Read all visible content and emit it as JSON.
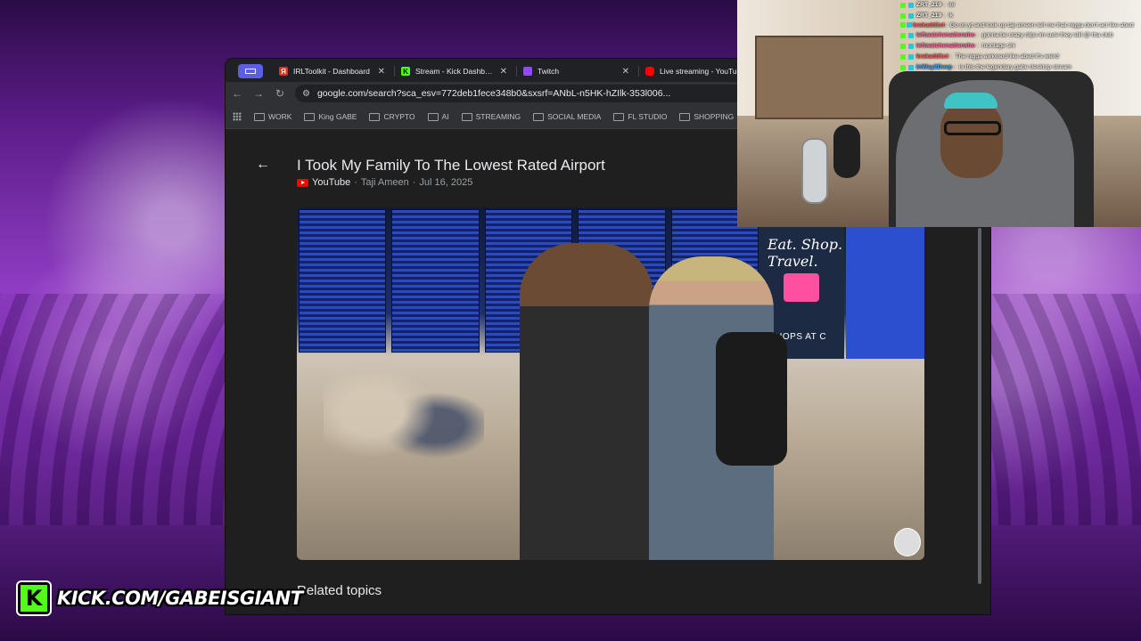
{
  "browser": {
    "tabs": [
      {
        "label": "IRLToolkit - Dashboard",
        "icon": "irltoolkit-icon",
        "color": "#d93025"
      },
      {
        "label": "Stream - Kick Dashboard",
        "icon": "kick-icon",
        "color": "#53fc18"
      },
      {
        "label": "Twitch",
        "icon": "twitch-icon",
        "color": "#9146ff"
      },
      {
        "label": "Live streaming - YouTube",
        "icon": "youtube-icon",
        "color": "#ff0000"
      }
    ],
    "url": "google.com/search?sca_esv=772deb1fece348b0&sxsrf=ANbL-n5HK-hZIlk-353l006...",
    "bookmarks": [
      "WORK",
      "King GABE",
      "CRYPTO",
      "AI",
      "STREAMING",
      "SOCIAL MEDIA",
      "FL STUDIO",
      "SHOPPING"
    ]
  },
  "video": {
    "title": "I Took My Family To The Lowest Rated Airport",
    "source": "YouTube",
    "channel": "Taji Ameen",
    "date": "Jul 16, 2025",
    "ad_text": "Eat. Shop. Travel.",
    "ad_shops": "SHOPS AT C"
  },
  "related_label": "Related topics",
  "chat": [
    {
      "user": "ZRT_219",
      "msg": "lol",
      "color": "#ffffff"
    },
    {
      "user": "ZRT_219",
      "msg": "lk",
      "color": "#ffffff"
    },
    {
      "user": "krakadd1ct",
      "msg": "Go on yt and look up taji ameen tell me that nigga don't act like abed",
      "color": "#ff5f5f"
    },
    {
      "user": "leftwatchenatterwho",
      "msg": "gonna be crazy clips im sure they still @ tha club",
      "color": "#ff6fa8"
    },
    {
      "user": "leftwatchenatterwho",
      "msg": "montage shi",
      "color": "#ff6fa8"
    },
    {
      "user": "krakadd1ct",
      "msg": "The nigga awkward like abed it's weird",
      "color": "#ff5f5f"
    },
    {
      "user": "InWay2Deep",
      "msg": "is this the legendary gabe desktop stream",
      "color": "#4aa3ff"
    }
  ],
  "kick_url": "KICK.COM/GABEISGIANT",
  "colors": {
    "kick_green": "#53fc18",
    "browser_bg": "#1f1f1f"
  }
}
